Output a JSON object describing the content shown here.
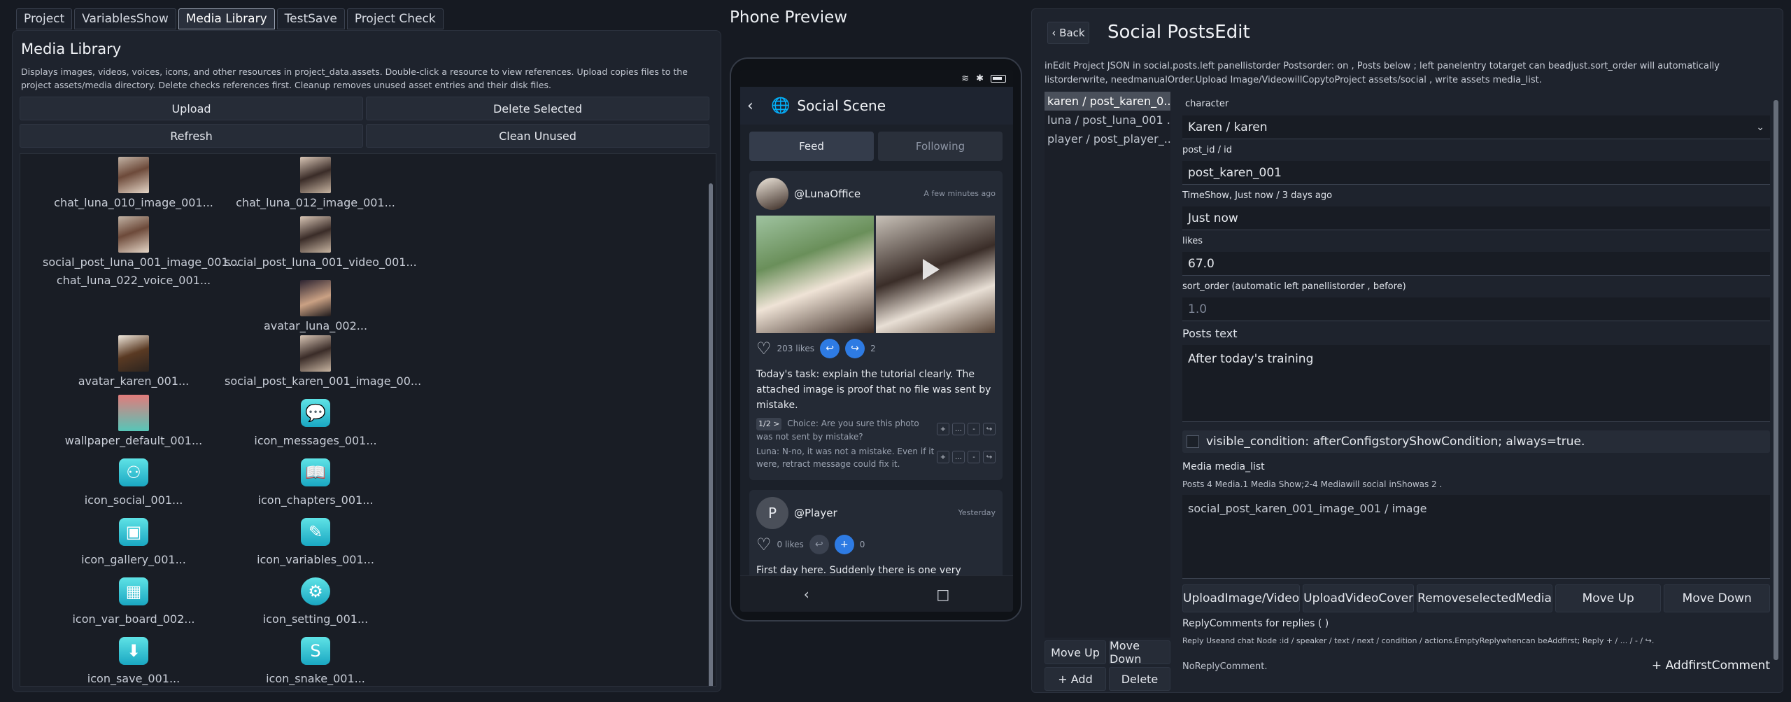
{
  "tabs": [
    "Project",
    "VariablesShow",
    "Media Library",
    "TestSave",
    "Project Check"
  ],
  "media": {
    "title": "Media Library",
    "description": "Displays images, videos, voices, icons, and other resources in project_data.assets. Double-click a resource to view references. Upload copies files to the project assets/media directory. Delete checks references first. Cleanup removes unused asset entries and their disk files.",
    "upload": "Upload",
    "delete_selected": "Delete Selected",
    "refresh": "Refresh",
    "clean_unused": "Clean Unused",
    "assets": [
      {
        "label": "chat_luna_010_image_001...",
        "icon": "photo"
      },
      {
        "label": "chat_luna_012_image_001...",
        "icon": "photo2"
      },
      {
        "label": "social_post_luna_001_image_001...",
        "icon": "photo"
      },
      {
        "label": "social_post_luna_001_video_001...",
        "icon": "photo2"
      },
      {
        "label": "chat_luna_022_voice_001...",
        "icon": "none"
      },
      {
        "label": "avatar_luna_002...",
        "icon": "dark"
      },
      {
        "label": "avatar_karen_001...",
        "icon": "karen"
      },
      {
        "label": "social_post_karen_001_image_00...",
        "icon": "photo2"
      },
      {
        "label": "wallpaper_default_001...",
        "icon": "wall"
      },
      {
        "label": "icon_messages_001...",
        "icon": "💬"
      },
      {
        "label": "icon_social_001...",
        "icon": "⚇"
      },
      {
        "label": "icon_chapters_001...",
        "icon": "📖"
      },
      {
        "label": "icon_gallery_001...",
        "icon": "▣"
      },
      {
        "label": "icon_variables_001...",
        "icon": "✎"
      },
      {
        "label": "icon_var_board_002...",
        "icon": "▦"
      },
      {
        "label": "icon_setting_001...",
        "icon": "⚙"
      },
      {
        "label": "icon_save_001...",
        "icon": "⬇"
      },
      {
        "label": "icon_snake_001...",
        "icon": "S"
      }
    ]
  },
  "phone": {
    "title": "Phone Preview",
    "app_title": "Social Scene",
    "tab_feed": "Feed",
    "tab_following": "Following",
    "post1": {
      "handle": "@LunaOffice",
      "time": "A few minutes ago",
      "likes": "203 likes",
      "reply_count": "2",
      "body": "Today's task: explain the tutorial clearly. The attached image is proof that no file was sent by mistake.",
      "choice_pill": "1/2 >",
      "choice_text": "Choice: Are you sure this photo was not sent by mistake?",
      "reply_text": "Luna: N-no, it was not a mistake. Even if it were, retract message could fix it."
    },
    "post2": {
      "avatar_letter": "P",
      "handle": "@Player",
      "time": "Yesterday",
      "likes": "0 likes",
      "reply_count": "0",
      "body": "First day here. Suddenly there is one very serious"
    }
  },
  "editor": {
    "back": "‹ Back",
    "title": "Social PostsEdit",
    "description": "inEdit Project JSON in social.posts.left panellistorder Postsorder: on , Posts below ; left panelentry totarget can beadjust.sort_order will automatically listorderwrite, needmanualOrder.Upload Image/VideowillCopytoProject assets/social , write assets media_list.",
    "posts": [
      "karen / post_karen_0...",
      "luna / post_luna_001 ...",
      "player / post_player_..."
    ],
    "move_up": "Move Up",
    "move_down": "Move Down",
    "add": "+ Add",
    "delete": "Delete",
    "character_label": "character",
    "character_value": "Karen / karen",
    "post_id_label": "post_id / id",
    "post_id_value": "post_karen_001",
    "time_label": "TimeShow, Just now / 3 days ago",
    "time_value": "Just now",
    "likes_label": "likes",
    "likes_value": "67.0",
    "sort_label": "sort_order (automatic left panellistorder , before)",
    "sort_value": "1.0",
    "text_label": "Posts text",
    "text_value": "After today's training",
    "visible_condition": "visible_condition: afterConfigstoryShowCondition; always=true.",
    "media_label": "Media media_list",
    "media_note": "Posts 4 Media.1 Media Show;2-4 Mediawill social inShowas 2 .",
    "media_value": "social_post_karen_001_image_001 / image",
    "btn_upload_media": "UploadImage/Video",
    "btn_upload_cover": "UploadVideoCover",
    "btn_remove_media": "RemoveselectedMedia",
    "btn_media_up": "Move Up",
    "btn_media_down": "Move Down",
    "reply_label": "ReplyComments for replies ( )",
    "reply_note": "Reply Useand chat Node :id / speaker / text / next / condition / actions.EmptyReplywhencan beAddfirst; Reply + / ... / - / ↪.",
    "no_reply": "NoReplyComment.",
    "add_first_comment": "+ AddfirstComment"
  }
}
